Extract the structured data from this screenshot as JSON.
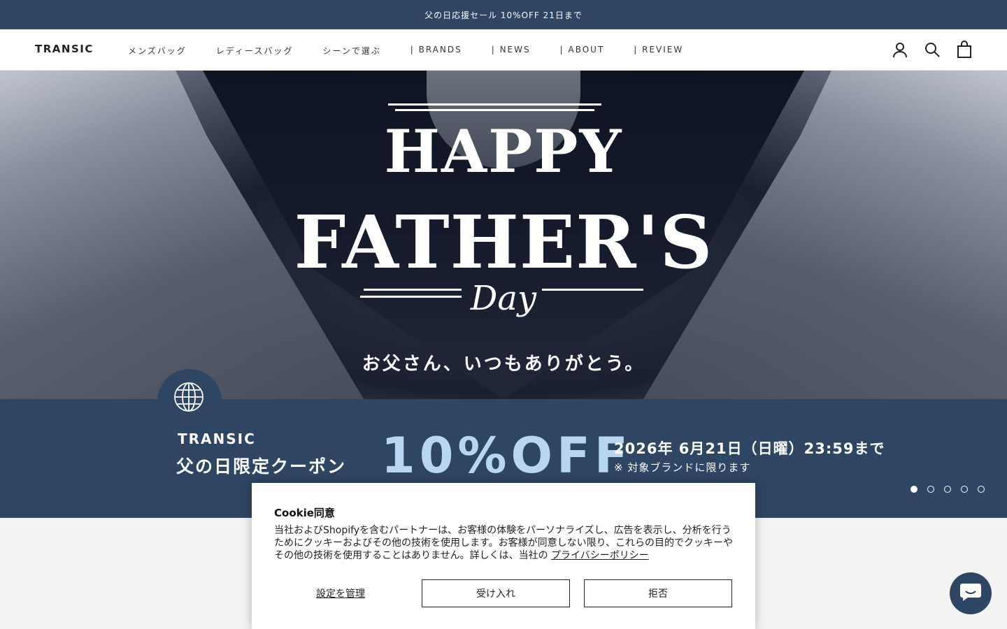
{
  "announcement": "父の日応援セール 10%OFF 21日まで",
  "header": {
    "logo": "TRANSIC",
    "nav": [
      "メンズバッグ",
      "レディースバッグ",
      "シーンで選ぶ",
      "| BRANDS",
      "| NEWS",
      "| ABOUT",
      "| REVIEW"
    ],
    "icons": [
      "account-icon",
      "search-icon",
      "cart-icon"
    ]
  },
  "hero": {
    "happy": "HAPPY",
    "fathers": "FATHER'S",
    "day": "Day",
    "subtitle": "お父さん、いつもありがとう。"
  },
  "banner": {
    "brand": "TRANSIC",
    "coupon": "父の日限定クーポン",
    "discount": "10%OFF",
    "date": "2026年 6月21日（日曜）23:59まで",
    "note": "※ 対象ブランドに限ります"
  },
  "slider": {
    "count": 5,
    "active": 1
  },
  "cookie": {
    "title": "Cookie同意",
    "body": "当社およびShopifyを含むパートナーは、お客様の体験をパーソナライズし、広告を表示し、分析を行うためにクッキーおよびその他の技術を使用します。お客様が同意しない限り、これらの目的でクッキーやその他の技術を使用することはありません。詳しくは、当社の",
    "link": "プライバシーポリシー",
    "manage": "設定を管理",
    "accept": "受け入れ",
    "decline": "拒否"
  },
  "colors": {
    "brand": "#2f4564",
    "accent": "#b8d6f2"
  }
}
